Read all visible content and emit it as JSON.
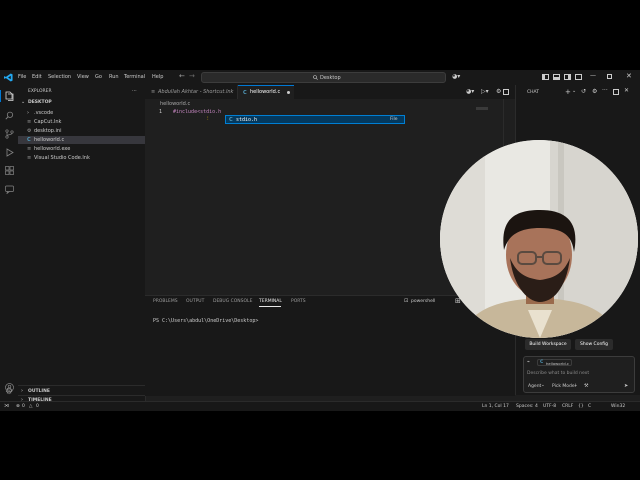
{
  "menu": [
    "File",
    "Edit",
    "Selection",
    "View",
    "Go",
    "Run",
    "Terminal",
    "Help"
  ],
  "search_label": "Desktop",
  "explorer": {
    "title": "EXPLORER",
    "folder": "DESKTOP",
    "files": [
      {
        "name": ".vscode",
        "icon": "chevron-right-icon",
        "glyph": "›"
      },
      {
        "name": "CapCut.lnk",
        "icon": "file-icon",
        "glyph": "≡"
      },
      {
        "name": "desktop.ini",
        "icon": "settings-file-icon",
        "glyph": "⚙"
      },
      {
        "name": "helloworld.c",
        "icon": "c-file-icon",
        "glyph": "C"
      },
      {
        "name": "helloworld.exe",
        "icon": "file-icon",
        "glyph": "≡"
      },
      {
        "name": "Visual Studio Code.lnk",
        "icon": "file-icon",
        "glyph": "≡"
      }
    ],
    "outline": "OUTLINE",
    "timeline": "TIMELINE"
  },
  "tabs": [
    {
      "label": "Abdullah Akhtar - Shortcut.lnk"
    },
    {
      "label": "helloworld.c"
    }
  ],
  "breadcrumb": "helloworld.c",
  "editor": {
    "line_number": "1",
    "code": "#include<stdio.h",
    "suggestion": {
      "label": "stdio.h",
      "kind": "File",
      "icon": "c-file-icon"
    }
  },
  "panel": {
    "tabs": [
      "PROBLEMS",
      "OUTPUT",
      "DEBUG CONSOLE",
      "TERMINAL",
      "PORTS"
    ],
    "active_tab": "TERMINAL",
    "shell": "powershell",
    "prompt": "PS C:\\Users\\abdul\\OneDrive\\Desktop>"
  },
  "chat": {
    "title": "CHAT",
    "buttons": [
      "Build Workspace",
      "Show Config"
    ],
    "context_file": "helloworld.c",
    "input_placeholder": "Describe what to build next",
    "mode": "Agent",
    "model": "Pick Model"
  },
  "status": {
    "errors": "0",
    "warnings": "0",
    "position": "Ln 1, Col 17",
    "spaces": "Spaces: 4",
    "encoding": "UTF-8",
    "eol": "CRLF",
    "language": "C",
    "platform": "Win32"
  },
  "colors": {
    "accent": "#0078d4",
    "keyword": "#c586c0",
    "string": "#ce9178",
    "suggest_bg": "#04395e",
    "c_icon": "#519aba"
  }
}
